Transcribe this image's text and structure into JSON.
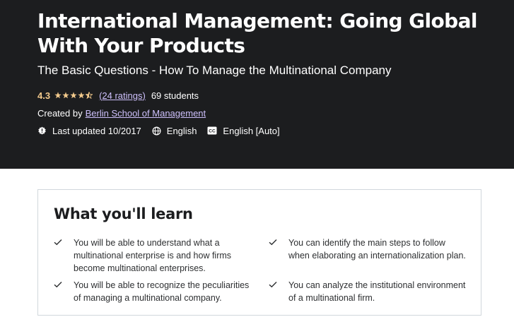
{
  "course": {
    "title": "International Management: Going Global With Your Products",
    "subtitle": "The Basic Questions - How To Manage the Multinational Company",
    "rating": "4.3",
    "stars_filled_fraction": 0.86,
    "ratings_link": "(24 ratings)",
    "students": "69 students",
    "created_by_label": "Created by",
    "author": "Berlin School of Management",
    "last_updated": "Last updated 10/2017",
    "language": "English",
    "captions": "English [Auto]",
    "icons": {
      "update": "alert-badge-icon",
      "language": "globe-icon",
      "captions": "closed-captions-icon"
    }
  },
  "learn": {
    "title": "What you'll learn",
    "items": [
      "You will be able to understand what a multinational enterprise is and how firms become multinational enterprises.",
      "You can identify the main steps to follow when elaborating an internationalization plan.",
      "You will be able to recognize the peculiarities of managing a multinational company.",
      "You can analyze the institutional environment of a multinational firm."
    ]
  },
  "colors": {
    "hero_bg": "#1c1d1f",
    "rating": "#f3ca8c",
    "link": "#cec0fc",
    "border": "#d1d7dc"
  }
}
